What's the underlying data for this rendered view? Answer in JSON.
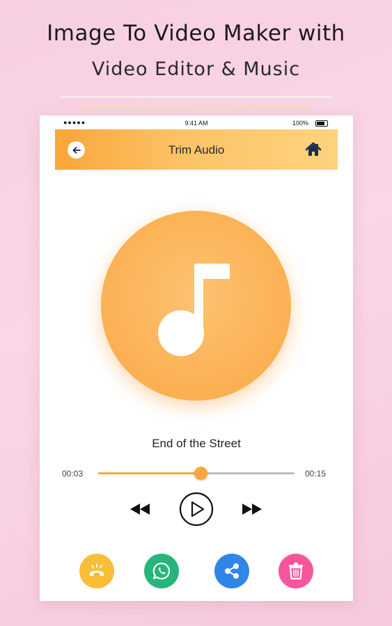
{
  "promo": {
    "headline": "Image To Video Maker with",
    "subline": "Video Editor & Music"
  },
  "status_bar": {
    "signal": "●●●●● ",
    "time": "9:41 AM",
    "battery": "100%"
  },
  "app_bar": {
    "title": "Trim Audio",
    "back_icon": "arrow-left-icon",
    "home_icon": "home-icon",
    "accent_start": "#f9a53a",
    "accent_end": "#fdd37e"
  },
  "player": {
    "song_title": "End of the Street",
    "current_time": "00:03",
    "total_time": "00:15",
    "progress": 0.52,
    "accent": "#f9a83c"
  },
  "controls": {
    "rewind_icon": "rewind-icon",
    "play_icon": "play-icon",
    "forward_icon": "fast-forward-icon"
  },
  "actions": [
    {
      "name": "set-ringtone-button",
      "icon": "phone-ring-icon",
      "color": "#f9be38"
    },
    {
      "name": "whatsapp-share-button",
      "icon": "whatsapp-icon",
      "color": "#27b57a"
    },
    {
      "name": "share-button",
      "icon": "share-icon",
      "color": "#2f86e6"
    },
    {
      "name": "delete-button",
      "icon": "trash-icon",
      "color": "#f4569b"
    }
  ]
}
